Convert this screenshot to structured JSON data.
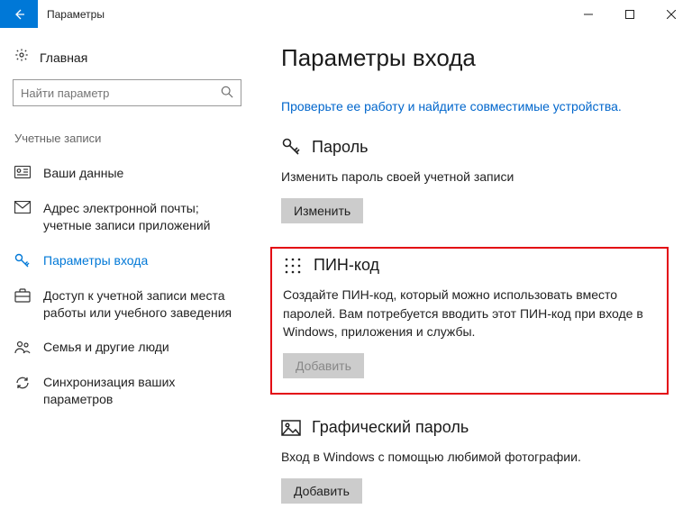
{
  "titlebar": {
    "title": "Параметры"
  },
  "sidebar": {
    "home": "Главная",
    "search_placeholder": "Найти параметр",
    "section": "Учетные записи",
    "items": [
      {
        "label": "Ваши данные"
      },
      {
        "label": "Адрес электронной почты; учетные записи приложений"
      },
      {
        "label": "Параметры входа"
      },
      {
        "label": "Доступ к учетной записи места работы или учебного заведения"
      },
      {
        "label": "Семья и другие люди"
      },
      {
        "label": "Синхронизация ваших параметров"
      }
    ]
  },
  "main": {
    "title": "Параметры входа",
    "check_link": "Проверьте ее работу и найдите совместимые устройства.",
    "password": {
      "title": "Пароль",
      "desc": "Изменить пароль своей учетной записи",
      "button": "Изменить"
    },
    "pin": {
      "title": "ПИН-код",
      "desc": "Создайте ПИН-код, который можно использовать вместо паролей. Вам потребуется вводить этот ПИН-код при входе в Windows, приложения и службы.",
      "button": "Добавить"
    },
    "picture": {
      "title": "Графический пароль",
      "desc": "Вход в Windows с помощью любимой фотографии.",
      "button": "Добавить"
    }
  }
}
